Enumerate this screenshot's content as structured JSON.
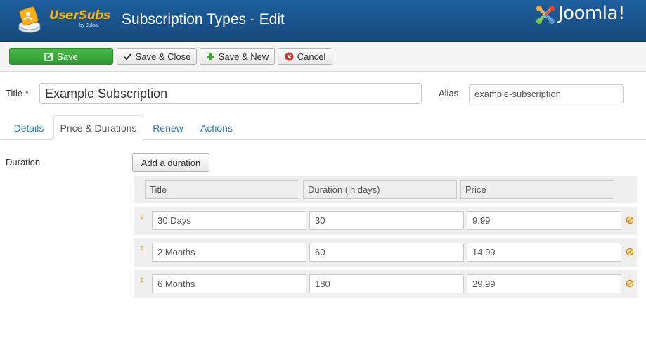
{
  "header": {
    "logo_text": "UserSubs",
    "logo_sub": "by Juloa",
    "page_title": "Subscription Types - Edit",
    "joomla_text": "Joomla!"
  },
  "toolbar": {
    "save_label": "Save",
    "save_close_label": "Save & Close",
    "save_new_label": "Save & New",
    "cancel_label": "Cancel"
  },
  "form": {
    "title_label": "Title *",
    "title_value": "Example Subscription",
    "alias_label": "Alias",
    "alias_value": "example-subscription"
  },
  "tabs": [
    {
      "label": "Details"
    },
    {
      "label": "Price & Durations"
    },
    {
      "label": "Renew"
    },
    {
      "label": "Actions"
    }
  ],
  "duration": {
    "label": "Duration",
    "add_button": "Add a duration",
    "columns": [
      "Title",
      "Duration (in days)",
      "Price"
    ],
    "rows": [
      {
        "title": "30 Days",
        "days": "30",
        "price": "9.99"
      },
      {
        "title": "2 Months",
        "days": "60",
        "price": "14.99"
      },
      {
        "title": "6 Months",
        "days": "180",
        "price": "29.99"
      }
    ]
  },
  "colors": {
    "header_bg": "#17497c",
    "save_green": "#3aa83b",
    "link_blue": "#2a7bbf",
    "handle_orange": "#e48a00",
    "logo_orange": "#f6b11b"
  }
}
